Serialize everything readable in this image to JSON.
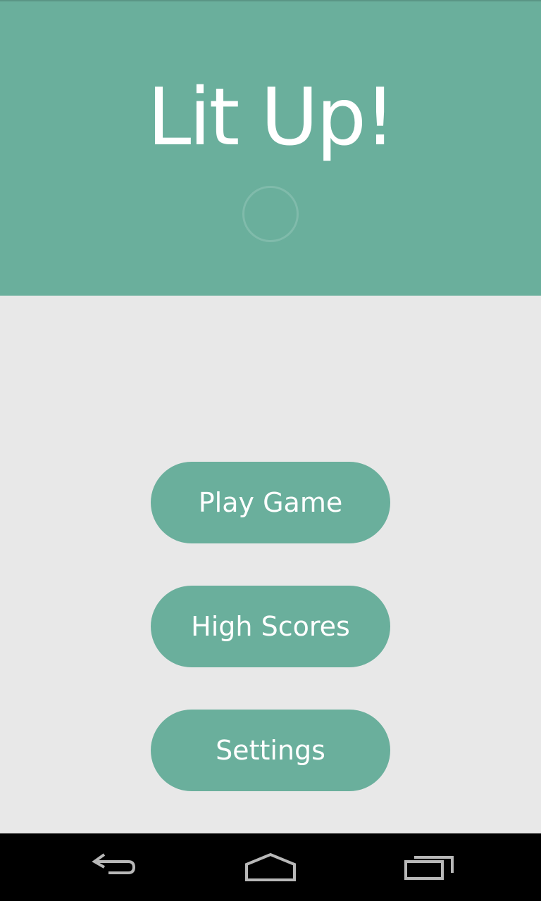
{
  "app": {
    "title": "Lit Up!"
  },
  "menu": {
    "play_label": "Play Game",
    "high_scores_label": "High Scores",
    "settings_label": "Settings"
  },
  "colors": {
    "accent": "#6aaf9c",
    "background": "#e8e8e8",
    "navbar": "#000000",
    "text_on_accent": "#ffffff"
  },
  "icons": {
    "loader": "loading-ring-icon",
    "back": "back-icon",
    "home": "home-icon",
    "recents": "recents-icon"
  }
}
